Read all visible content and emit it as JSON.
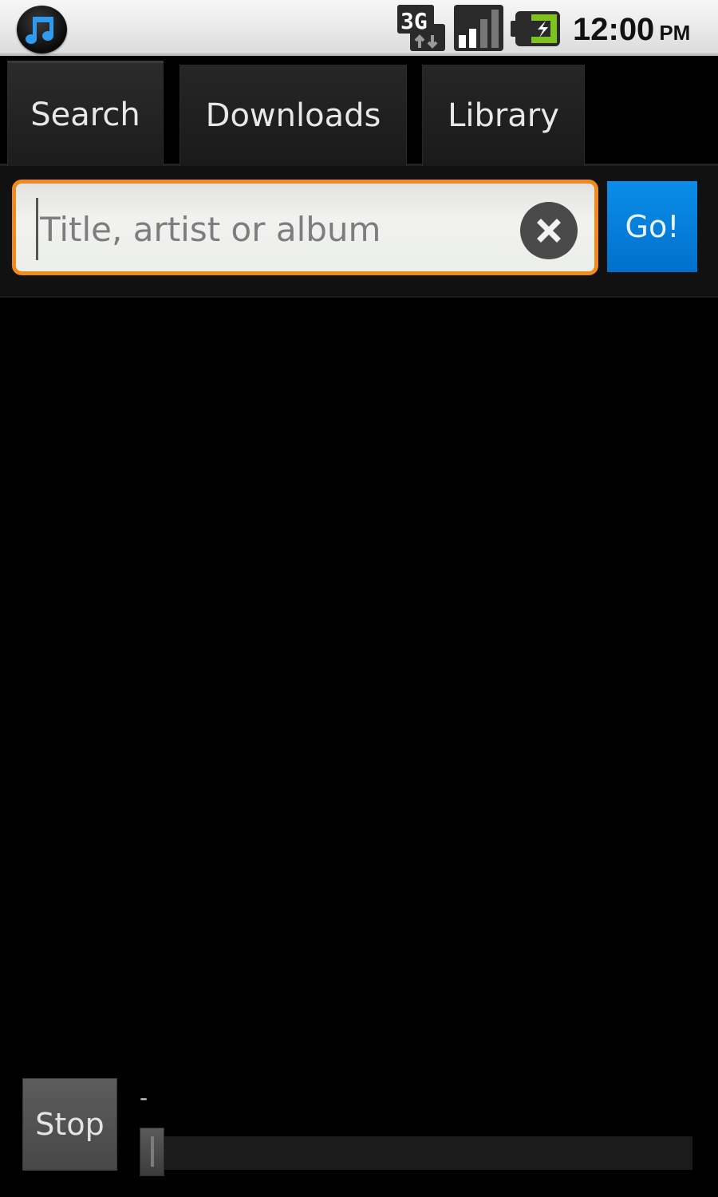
{
  "status_bar": {
    "app_icon": "music-note-icon",
    "network_type": "3G",
    "network_icon": "3g-data-icon",
    "signal_icon": "signal-strength-icon",
    "signal_bars": 2,
    "signal_bars_max": 4,
    "battery_icon": "battery-charging-icon",
    "time": "12:00",
    "ampm": "PM"
  },
  "tabs": [
    {
      "label": "Search",
      "active": true
    },
    {
      "label": "Downloads",
      "active": false
    },
    {
      "label": "Library",
      "active": false
    }
  ],
  "search": {
    "value": "",
    "placeholder": "Title, artist or album",
    "clear_icon": "clear-icon",
    "go_label": "Go!"
  },
  "player": {
    "stop_label": "Stop",
    "track_label": "-",
    "progress_percent": 0
  },
  "colors": {
    "focus_border": "#f08a1c",
    "go_button": "#0a84e0",
    "battery_charge": "#7dc21e",
    "music_icon": "#2e9bf0"
  }
}
